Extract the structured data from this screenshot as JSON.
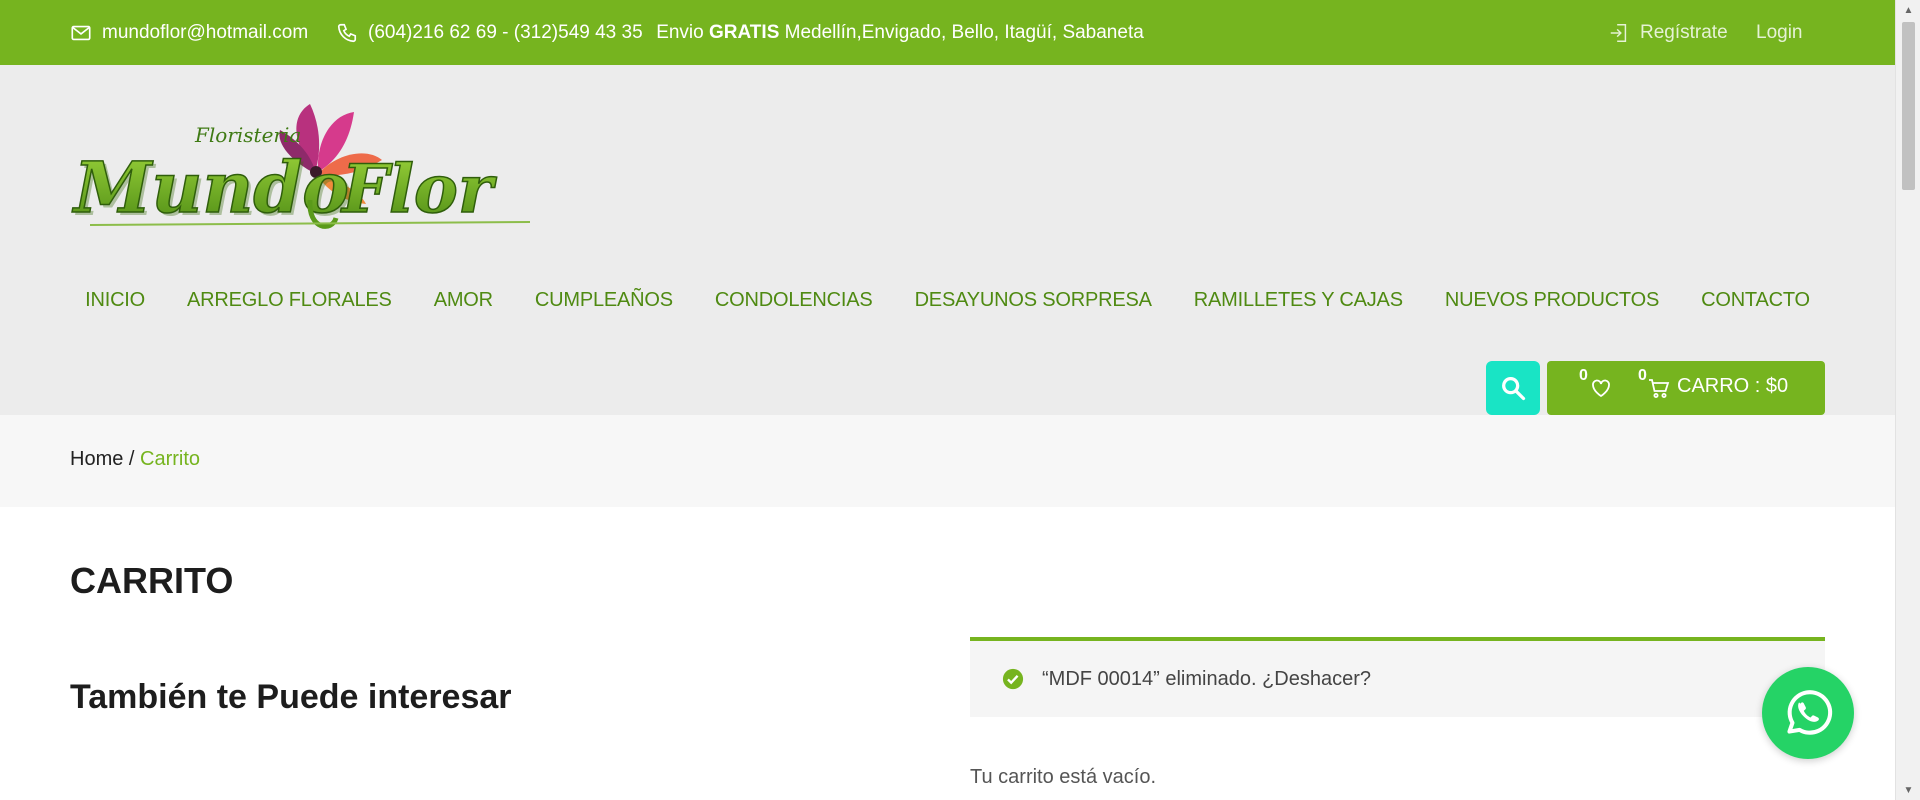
{
  "topbar": {
    "email": "mundoflor@hotmail.com",
    "phones": "(604)216 62 69 - (312)549 43 35",
    "promo_prefix": "Envio",
    "promo_bold": "GRATIS",
    "promo_rest": "Medellín,Envigado, Bello, Itagüí, Sabaneta",
    "register": "Regístrate",
    "login": "Login",
    "icons": [
      "envelope-icon",
      "phone-icon",
      "login-icon"
    ]
  },
  "logo": {
    "small_text": "Floristeria",
    "word1": "Mundo",
    "word2": "Flor"
  },
  "nav": {
    "items": [
      {
        "label": "INICIO"
      },
      {
        "label": "ARREGLO FLORALES"
      },
      {
        "label": "AMOR"
      },
      {
        "label": "CUMPLEAÑOS"
      },
      {
        "label": "CONDOLENCIAS"
      },
      {
        "label": "DESAYUNOS SORPRESA"
      },
      {
        "label": "RAMILLETES Y CAJAS"
      },
      {
        "label": "NUEVOS PRODUCTOS"
      },
      {
        "label": "CONTACTO"
      }
    ]
  },
  "header": {
    "wishlist_count": "0",
    "cart_count": "0",
    "cart_label": "CARRO : $0",
    "icons": [
      "search-icon",
      "heart-icon",
      "cart-icon"
    ]
  },
  "breadcrumb": {
    "home": "Home",
    "separator": " / ",
    "current": "Carrito"
  },
  "main": {
    "title": "CARRITO",
    "subtitle": "También te Puede interesar",
    "notice": "“MDF 00014” eliminado. ¿Deshacer?",
    "empty_text": "Tu carrito está vacío."
  },
  "colors": {
    "brand_green": "#76b41f",
    "nav_green": "#4f8a12",
    "search_teal": "#19e4c5",
    "whatsapp": "#25d366"
  }
}
